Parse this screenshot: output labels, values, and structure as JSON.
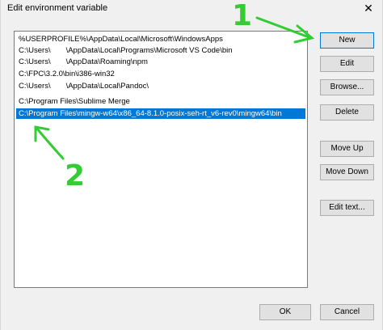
{
  "window": {
    "title": "Edit environment variable",
    "close_glyph": "✕"
  },
  "path_list": {
    "entries": [
      "%USERPROFILE%\\AppData\\Local\\Microsoft\\WindowsApps",
      "C:\\Users\\  \\AppData\\Local\\Programs\\Microsoft VS Code\\bin",
      "C:\\Users\\  \\AppData\\Roaming\\npm",
      "C:\\FPC\\3.2.0\\bin\\i386-win32",
      "C:\\Users\\  \\AppData\\Local\\Pandoc\\",
      "C:\\Program Files\\Sublime Merge",
      "C:\\Program Files\\mingw-w64\\x86_64-8.1.0-posix-seh-rt_v6-rev0\\mingw64\\bin"
    ],
    "selected_index": 6
  },
  "buttons": {
    "new": "New",
    "edit": "Edit",
    "browse": "Browse...",
    "delete": "Delete",
    "move_up": "Move Up",
    "move_down": "Move Down",
    "edit_text": "Edit text...",
    "ok": "OK",
    "cancel": "Cancel"
  },
  "annotations": {
    "step1": "1",
    "step2": "2",
    "color": "#33cc33"
  },
  "colors": {
    "selection": "#0078d7",
    "button_face": "#e1e1e1"
  }
}
